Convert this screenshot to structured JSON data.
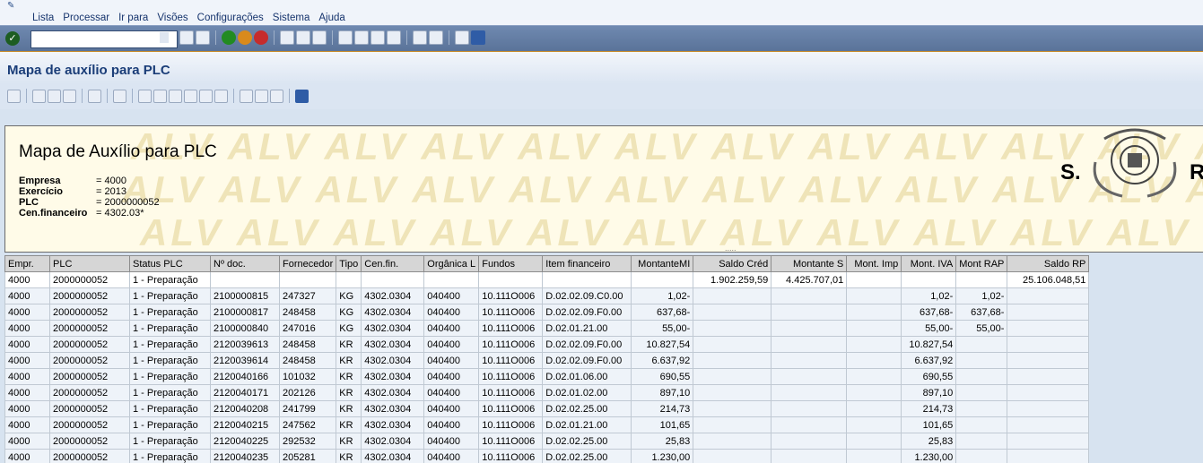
{
  "menu": [
    "Lista",
    "Processar",
    "Ir para",
    "Visões",
    "Configurações",
    "Sistema",
    "Ajuda"
  ],
  "page_title": "Mapa de auxílio para PLC",
  "header": {
    "title": "Mapa de Auxílio para PLC",
    "fields": [
      {
        "label": "Empresa",
        "value": "= 4000"
      },
      {
        "label": "Exercício",
        "value": "= 2013"
      },
      {
        "label": "PLC",
        "value": "= 2000000052"
      },
      {
        "label": "Cen.financeiro",
        "value": "= 4302.03*"
      }
    ],
    "logo_left": "S.",
    "logo_right": "R.",
    "watermark": "ALV"
  },
  "table": {
    "columns": [
      "Empr.",
      "PLC",
      "Status PLC",
      "Nº doc.",
      "Fornecedor",
      "Tipo",
      "Cen.fin.",
      "Orgânica L",
      "Fundos",
      "Item financeiro",
      "MontanteMI",
      "Saldo Créd",
      "Montante S",
      "Mont. Imp",
      "Mont. IVA",
      "Mont RAP",
      "Saldo RP"
    ],
    "rows": [
      [
        "4000",
        "2000000052",
        "1 - Preparação",
        "",
        "",
        "",
        "",
        "",
        "",
        "",
        "",
        "1.902.259,59",
        "4.425.707,01",
        "",
        "",
        "",
        "25.106.048,51"
      ],
      [
        "4000",
        "2000000052",
        "1 - Preparação",
        "2100000815",
        "247327",
        "KG",
        "4302.0304",
        "040400",
        "10.111O006",
        "D.02.02.09.C0.00",
        "1,02-",
        "",
        "",
        "",
        "1,02-",
        "1,02-",
        ""
      ],
      [
        "4000",
        "2000000052",
        "1 - Preparação",
        "2100000817",
        "248458",
        "KG",
        "4302.0304",
        "040400",
        "10.111O006",
        "D.02.02.09.F0.00",
        "637,68-",
        "",
        "",
        "",
        "637,68-",
        "637,68-",
        ""
      ],
      [
        "4000",
        "2000000052",
        "1 - Preparação",
        "2100000840",
        "247016",
        "KG",
        "4302.0304",
        "040400",
        "10.111O006",
        "D.02.01.21.00",
        "55,00-",
        "",
        "",
        "",
        "55,00-",
        "55,00-",
        ""
      ],
      [
        "4000",
        "2000000052",
        "1 - Preparação",
        "2120039613",
        "248458",
        "KR",
        "4302.0304",
        "040400",
        "10.111O006",
        "D.02.02.09.F0.00",
        "10.827,54",
        "",
        "",
        "",
        "10.827,54",
        "",
        ""
      ],
      [
        "4000",
        "2000000052",
        "1 - Preparação",
        "2120039614",
        "248458",
        "KR",
        "4302.0304",
        "040400",
        "10.111O006",
        "D.02.02.09.F0.00",
        "6.637,92",
        "",
        "",
        "",
        "6.637,92",
        "",
        ""
      ],
      [
        "4000",
        "2000000052",
        "1 - Preparação",
        "2120040166",
        "101032",
        "KR",
        "4302.0304",
        "040400",
        "10.111O006",
        "D.02.01.06.00",
        "690,55",
        "",
        "",
        "",
        "690,55",
        "",
        ""
      ],
      [
        "4000",
        "2000000052",
        "1 - Preparação",
        "2120040171",
        "202126",
        "KR",
        "4302.0304",
        "040400",
        "10.111O006",
        "D.02.01.02.00",
        "897,10",
        "",
        "",
        "",
        "897,10",
        "",
        ""
      ],
      [
        "4000",
        "2000000052",
        "1 - Preparação",
        "2120040208",
        "241799",
        "KR",
        "4302.0304",
        "040400",
        "10.111O006",
        "D.02.02.25.00",
        "214,73",
        "",
        "",
        "",
        "214,73",
        "",
        ""
      ],
      [
        "4000",
        "2000000052",
        "1 - Preparação",
        "2120040215",
        "247562",
        "KR",
        "4302.0304",
        "040400",
        "10.111O006",
        "D.02.01.21.00",
        "101,65",
        "",
        "",
        "",
        "101,65",
        "",
        ""
      ],
      [
        "4000",
        "2000000052",
        "1 - Preparação",
        "2120040225",
        "292532",
        "KR",
        "4302.0304",
        "040400",
        "10.111O006",
        "D.02.02.25.00",
        "25,83",
        "",
        "",
        "",
        "25,83",
        "",
        ""
      ],
      [
        "4000",
        "2000000052",
        "1 - Preparação",
        "2120040235",
        "205281",
        "KR",
        "4302.0304",
        "040400",
        "10.111O006",
        "D.02.02.25.00",
        "1.230,00",
        "",
        "",
        "",
        "1.230,00",
        "",
        ""
      ]
    ]
  },
  "colors": {
    "title": "#1a3d78",
    "toolbar": "#5a7399",
    "accent": "#c98c2a",
    "header_bg": "#fffbe8"
  }
}
